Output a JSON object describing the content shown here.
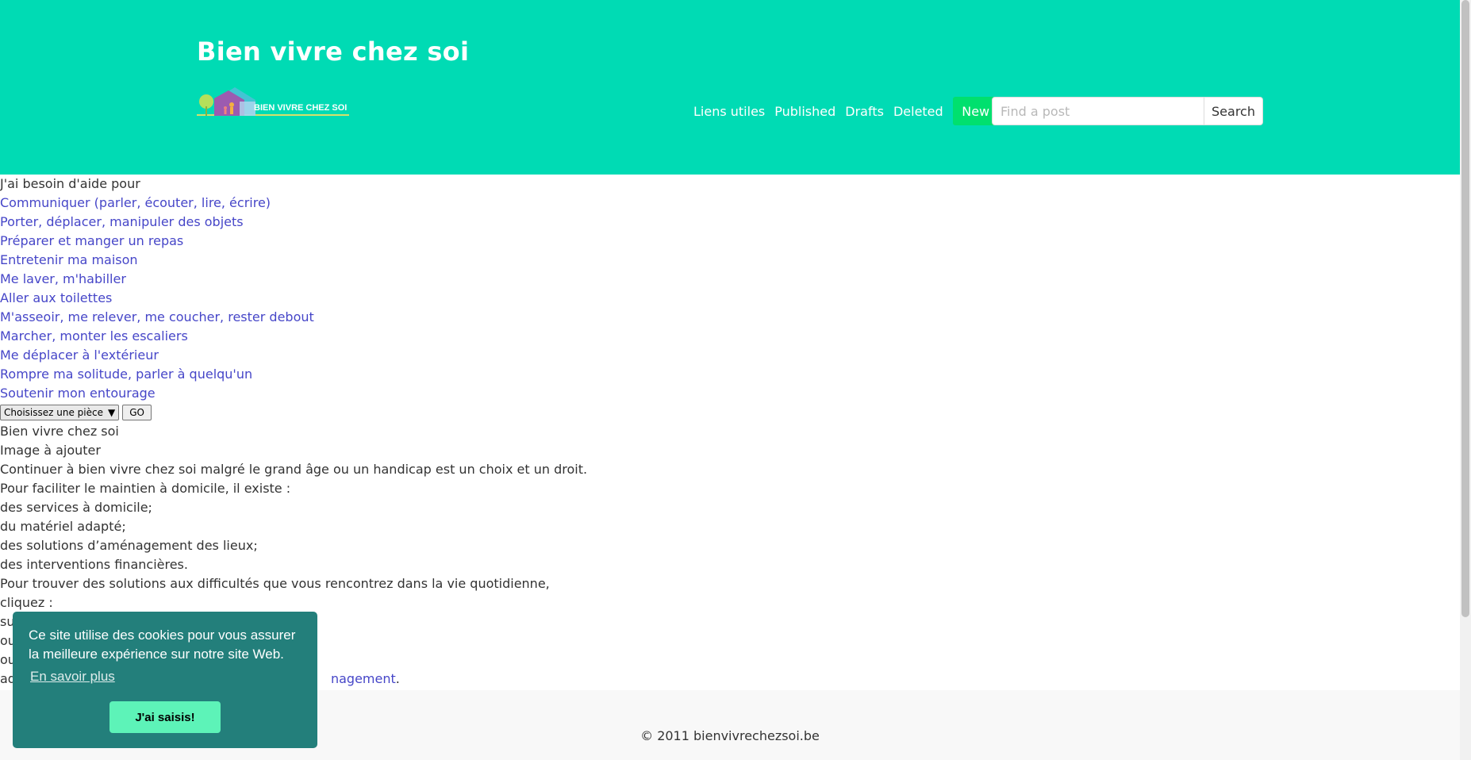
{
  "header": {
    "site_title": "Bien vivre chez soi",
    "logo_text": "BIEN VIVRE CHEZ SOI"
  },
  "nav": {
    "items": [
      "Liens utiles",
      "Published",
      "Drafts",
      "Deleted"
    ],
    "new_label": "New"
  },
  "search": {
    "placeholder": "Find a post",
    "button_label": "Search"
  },
  "main": {
    "intro": "J'ai besoin d'aide pour",
    "links": [
      "Communiquer (parler, écouter, lire, écrire)",
      "Porter, déplacer, manipuler des objets",
      "Préparer et manger un repas",
      "Entretenir ma maison",
      "Me laver, m'habiller",
      "Aller aux toilettes",
      "M'asseoir, me relever, me coucher, rester debout",
      "Marcher, monter les escaliers",
      "Me déplacer à l'extérieur",
      "Rompre ma solitude, parler à quelqu'un",
      "Soutenir mon entourage"
    ],
    "select_value": "Choisissez une pièce",
    "go_label": "GO",
    "section_title": "Bien vivre chez soi",
    "image_alt": "Image à ajouter",
    "paragraphs": [
      "Continuer à bien vivre chez soi malgré le grand âge ou un handicap est un choix et un droit.",
      "Pour faciliter le maintien à domicile, il existe :",
      "des services à domicile;",
      "du matériel adapté;",
      "des solutions d’aménagement des lieux;",
      "des interventions financières.",
      "Pour trouver des solutions aux difficultés que vous rencontrez dans la vie quotidienne,",
      "cliquez :",
      "su",
      "ou",
      "ou"
    ],
    "last_prefix": "ad",
    "last_link": "nagement",
    "last_suffix": "."
  },
  "footer": {
    "copyright": "© 2011 bienvivrechezsoi.be"
  },
  "cookie": {
    "message": "Ce site utilise des cookies pour vous assurer la meilleure expérience sur notre site Web.",
    "learn_more": "En savoir plus",
    "accept": "J'ai saisis!"
  },
  "colors": {
    "header_bg": "#00dbb4",
    "new_button": "#00e06e",
    "link": "#4646c8",
    "cookie_bg": "#237f7b",
    "cookie_button": "#5df3b8"
  },
  "icons": {
    "select_arrow": "dropdown-arrow-icon",
    "logo": "house-logo-icon"
  }
}
